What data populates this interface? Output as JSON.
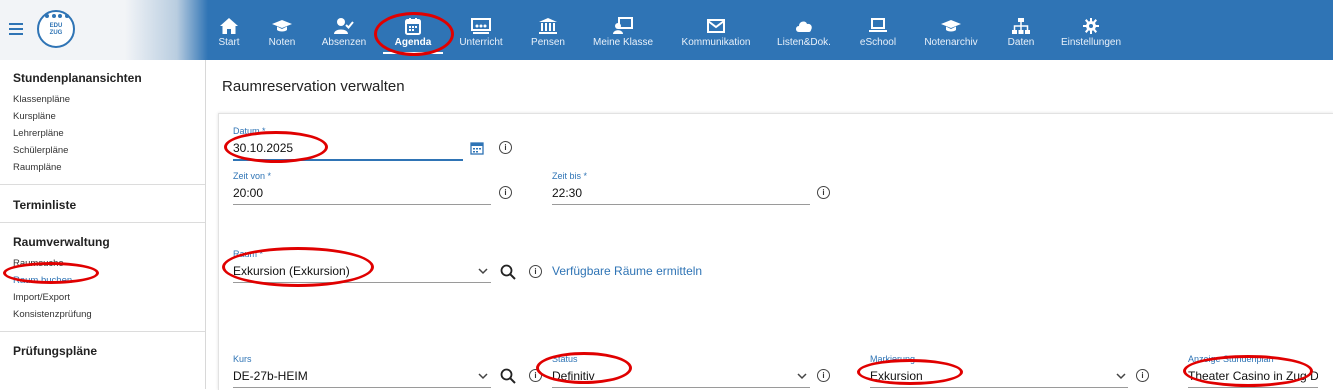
{
  "logo": {
    "line1": "EDU",
    "line2": "ZUG"
  },
  "nav": [
    {
      "label": "Start",
      "icon": "home-icon"
    },
    {
      "label": "Noten",
      "icon": "graduation-cap-icon"
    },
    {
      "label": "Absenzen",
      "icon": "user-check-icon"
    },
    {
      "label": "Agenda",
      "icon": "calendar-icon",
      "active": true
    },
    {
      "label": "Unterricht",
      "icon": "chalkboard-icon"
    },
    {
      "label": "Pensen",
      "icon": "institution-icon"
    },
    {
      "label": "Meine Klasse",
      "icon": "teacher-board-icon"
    },
    {
      "label": "Kommunikation",
      "icon": "envelope-icon"
    },
    {
      "label": "Listen&Dok.",
      "icon": "cloud-icon"
    },
    {
      "label": "eSchool",
      "icon": "laptop-icon"
    },
    {
      "label": "Notenarchiv",
      "icon": "archive-cap-icon"
    },
    {
      "label": "Daten",
      "icon": "sitemap-icon"
    },
    {
      "label": "Einstellungen",
      "icon": "gear-icon"
    }
  ],
  "sidebar": {
    "sections": [
      {
        "title": "Stundenplanansichten",
        "links": [
          "Klassenpläne",
          "Kurspläne",
          "Lehrerpläne",
          "Schülerpläne",
          "Raumpläne"
        ]
      },
      {
        "title": "Terminliste",
        "links": []
      },
      {
        "title": "Raumverwaltung",
        "links": [
          "Raumsuche",
          "Raum buchen",
          "Import/Export",
          "Konsistenzprüfung"
        ]
      },
      {
        "title": "Prüfungspläne",
        "links": []
      }
    ],
    "active_link": "Raum buchen"
  },
  "page": {
    "title": "Raumreservation verwalten"
  },
  "form": {
    "datum": {
      "label": "Datum *",
      "value": "30.10.2025"
    },
    "zeit_von": {
      "label": "Zeit von *",
      "value": "20:00"
    },
    "zeit_bis": {
      "label": "Zeit bis *",
      "value": "22:30"
    },
    "raum": {
      "label": "Raum *",
      "value": "Exkursion (Exkursion)"
    },
    "raeume_link": "Verfügbare Räume ermitteln",
    "kurs": {
      "label": "Kurs",
      "value": "DE-27b-HEIM"
    },
    "status": {
      "label": "Status",
      "value": "Definitiv"
    },
    "markierung": {
      "label": "Markierung",
      "value": "Exkursion"
    },
    "anzeige": {
      "label": "Anzeige Stundenplan",
      "value": "Theater Casino in Zug De"
    }
  },
  "colors": {
    "primary": "#2f74b5",
    "highlight": "#e00000"
  }
}
